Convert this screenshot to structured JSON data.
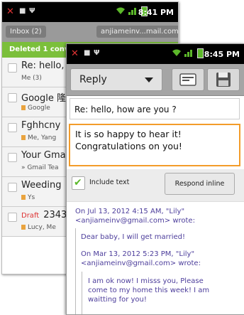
{
  "back": {
    "status_time": "8:41 PM",
    "header": {
      "inbox_label": "Inbox (2)",
      "account_label": "anjiameinv...mail.com"
    },
    "deleted_banner": "Deleted 1 conv",
    "conversations": [
      {
        "subject": "Re: hello,",
        "sub": "Me (3)",
        "draft": "",
        "label": false
      },
      {
        "subject": "Google 隆",
        "sub": "Google",
        "draft": "",
        "label": true
      },
      {
        "subject": "Fghhcny",
        "sub": "Me, Yang",
        "draft": "",
        "label": true
      },
      {
        "subject": "Your Gma",
        "sub": "» Gmail Tea",
        "draft": "",
        "label": false
      },
      {
        "subject": "Weeding",
        "sub": "Ys",
        "draft": "",
        "label": true
      },
      {
        "subject": "2343",
        "sub": "Lucy, Me",
        "draft": "Draft",
        "label": true
      }
    ]
  },
  "front": {
    "status_time": "8:45 PM",
    "reply_label": "Reply",
    "icons": {
      "details": "card-icon",
      "save": "floppy-disk-icon"
    },
    "subject": "Re: hello, how are you ?",
    "body_line1": "It is so happy to hear it!",
    "body_line2": "Congratulations on you!",
    "include_text": "Include text",
    "include_checked": true,
    "respond_inline": "Respond inline",
    "quoted": {
      "line1": "On Jul 13, 2012 4:15 AM,    \"Lily\"",
      "line2": "<anjiameinv@gmail.com> wrote:",
      "line3": "Dear baby, I will get married!",
      "line4": "On Mar 13, 2012 5:23 PM, \"Lily\"",
      "line5": "<anjiameinv@gmail.com> wrote:",
      "line6": "I am ok now! I misss you, Please",
      "line7": "come to my home this week! I am",
      "line8": "waitting for you!"
    },
    "accent_color": "#f39c2a",
    "quote_color": "#4c3d9b"
  }
}
